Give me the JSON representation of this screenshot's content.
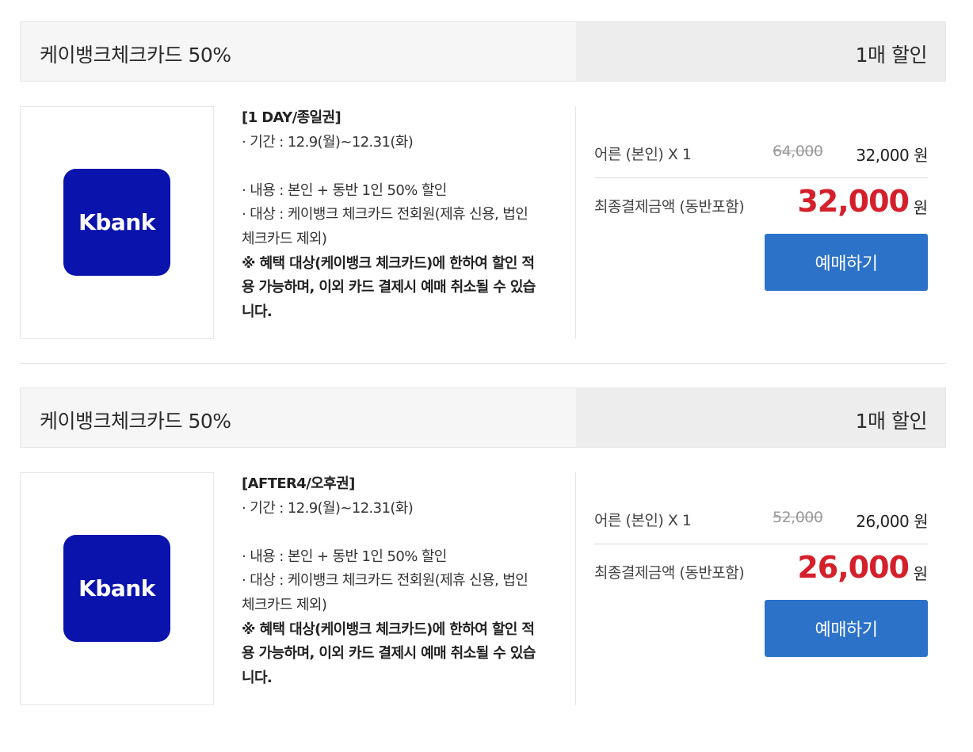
{
  "offers": [
    {
      "title": "케이뱅크체크카드 50%",
      "qty": "1매 할인",
      "logo_text": "Kbank",
      "ticket_name": "[1 DAY/종일권]",
      "period": " · 기간 : 12.9(월)~12.31(화)",
      "content": " · 내용 : 본인 + 동반 1인 50% 할인",
      "target": " · 대상 : 케이뱅크 체크카드 전회원(제휴 신용, 법인 체크카드 제외)",
      "notice": "※ 혜택 대상(케이뱅크 체크카드)에 한하여 할인 적용 가능하며, 이외 카드 결제시 예매 취소될 수 있습니다.",
      "person_label": "어른 (본인) X 1",
      "original_price": "64,000",
      "price": "32,000 원",
      "final_label": "최종결제금액 (동반포함)",
      "final_price": "32,000",
      "won": "원",
      "button": "예매하기"
    },
    {
      "title": "케이뱅크체크카드 50%",
      "qty": "1매 할인",
      "logo_text": "Kbank",
      "ticket_name": "[AFTER4/오후권]",
      "period": " · 기간 : 12.9(월)~12.31(화)",
      "content": " · 내용 : 본인 + 동반 1인 50% 할인",
      "target": " · 대상 : 케이뱅크 체크카드 전회원(제휴 신용, 법인 체크카드 제외)",
      "notice": "※ 혜택 대상(케이뱅크 체크카드)에 한하여 할인 적용 가능하며, 이외 카드 결제시 예매 취소될 수 있습니다.",
      "person_label": "어른 (본인) X 1",
      "original_price": "52,000",
      "price": "26,000 원",
      "final_label": "최종결제금액 (동반포함)",
      "final_price": "26,000",
      "won": "원",
      "button": "예매하기"
    }
  ],
  "colors": {
    "brand_logo": "#0a13ac",
    "button": "#2b72c8",
    "final_price": "#d4202b"
  }
}
